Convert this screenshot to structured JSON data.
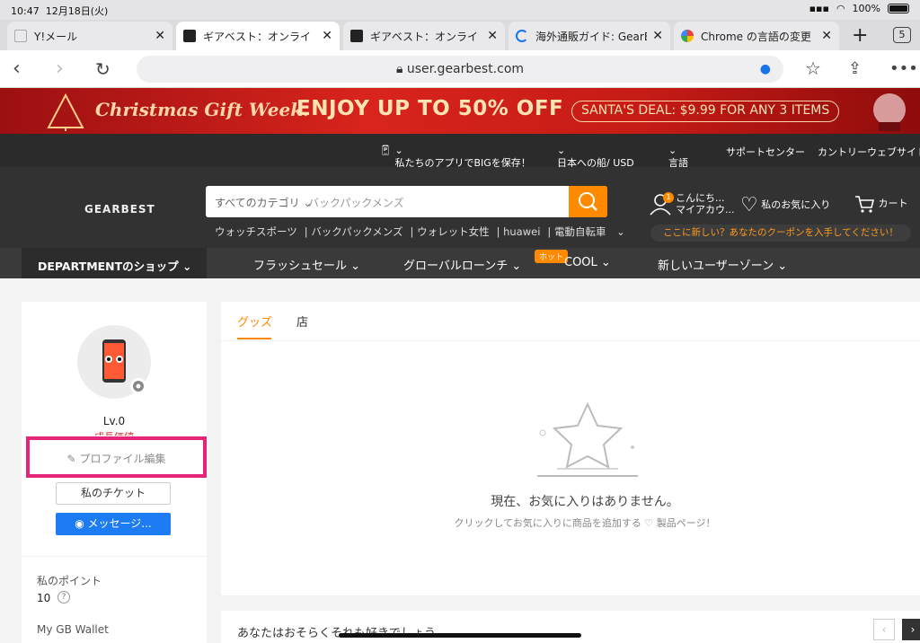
{
  "status": {
    "time": "10:47",
    "date": "12月18日(火)",
    "battery": "100%"
  },
  "tabs": [
    {
      "title": "Y!メール",
      "fav_color": "#e9e9eb"
    },
    {
      "title": "ギアベスト：オンライ",
      "fav_color": "#222"
    },
    {
      "title": "ギアベスト：オンライ",
      "fav_color": "#222"
    },
    {
      "title": "海外通販ガイド: GearBe",
      "fav_color": "#1a73e8"
    },
    {
      "title": "Chrome の言語の変更",
      "fav_color": "#ea4335"
    }
  ],
  "tab_count": "5",
  "url": "user.gearbest.com",
  "banner": {
    "title": "Christmas Gift Week.",
    "offer": "ENJOY UP TO 50% OFF",
    "deal": "SANTA'S DEAL: $9.99 FOR ANY 3 ITEMS"
  },
  "topnav": {
    "app": "私たちのアプリでBIGを保存！",
    "shipping": "日本への船/ USD",
    "language": "言語",
    "support": "サポートセンター",
    "country": "カントリーウェブサイト"
  },
  "header": {
    "logo": "GEARBEST",
    "search_category": "すべてのカテゴリ",
    "search_placeholder": "バックパックメンズ",
    "hotwords": [
      "ウォッチスポーツ",
      "バックパックメンズ",
      "ウォレット女性",
      "huawei",
      "電動自転車"
    ],
    "account_line1": "こんにち...",
    "account_line2": "マイアカウ...",
    "account_badge": "1",
    "favorites": "私のお気に入り",
    "cart": "カート",
    "promo": "ここに新しい？あなたのクーポンを入手してください！"
  },
  "catbar": {
    "department": "DEPARTMENTのショップ",
    "items": [
      "フラッシュセール",
      "グローバルローンチ",
      "COOL",
      "新しいユーザーゾーン"
    ],
    "hot_badge": "ホット"
  },
  "profile": {
    "level": "Lv.0",
    "level_sub": "成長価値",
    "edit": "プロファイル編集",
    "ticket": "私のチケット",
    "message": "メッセージ...",
    "points_label": "私のポイント",
    "points_value": "10",
    "wallet_label": "My GB Wallet"
  },
  "main": {
    "tab_goods": "グッズ",
    "tab_shop": "店",
    "empty_title": "現在、お気に入りはありません。",
    "empty_sub": "クリックしてお気に入りに商品を追加する ♡ 製品ページ！",
    "may_like": "あなたはおそらくそれも好きでしょう"
  },
  "colors": {
    "accent": "#ff8a00",
    "highlight": "#e6247a",
    "messenger": "#1e7cf2"
  }
}
